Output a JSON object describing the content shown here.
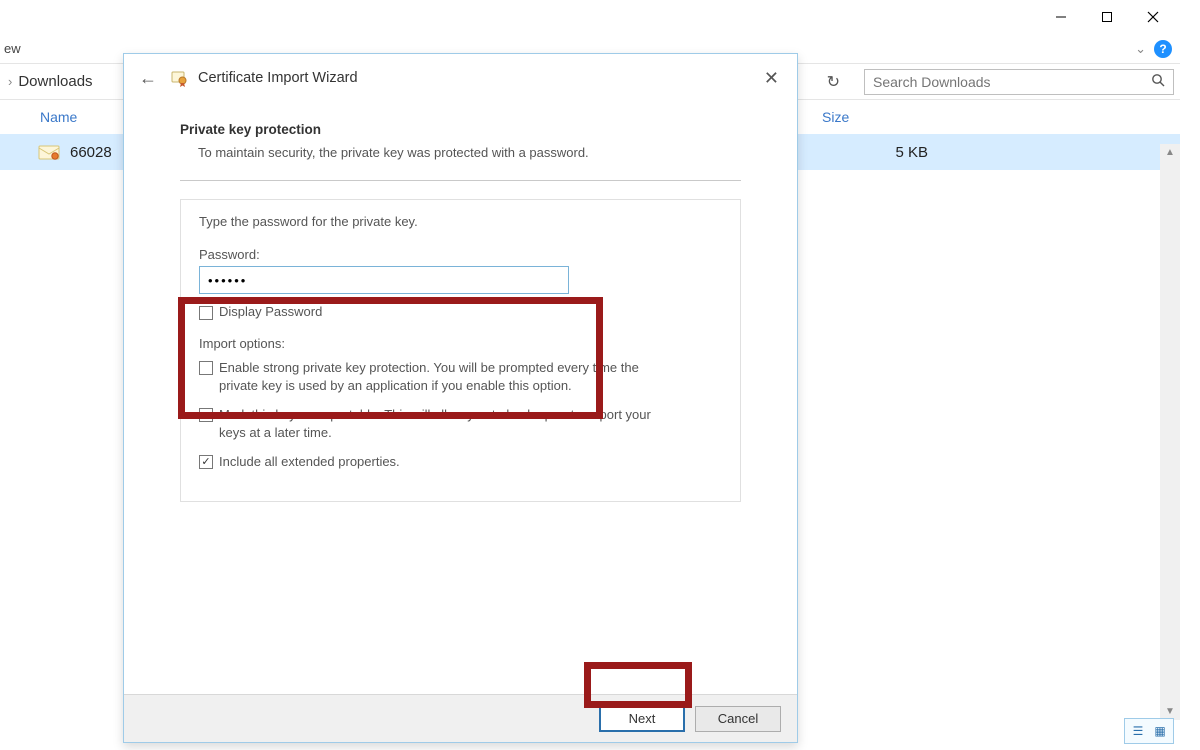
{
  "explorer": {
    "ribbon_tab": "ew",
    "breadcrumb": [
      "Downloads"
    ],
    "refresh_tooltip": "Refresh",
    "search_placeholder": "Search Downloads",
    "columns": {
      "name": "Name",
      "size": "Size"
    },
    "file": {
      "name": "66028",
      "size": "5 KB"
    }
  },
  "wizard": {
    "title": "Certificate Import Wizard",
    "section_title": "Private key protection",
    "section_sub": "To maintain security, the private key was protected with a password.",
    "instruction": "Type the password for the private key.",
    "password_label": "Password:",
    "password_value": "••••••",
    "display_password_label": "Display Password",
    "display_password_checked": false,
    "import_options_label": "Import options:",
    "opt_strong": "Enable strong private key protection. You will be prompted every time the private key is used by an application if you enable this option.",
    "opt_strong_checked": false,
    "opt_exportable": "Mark this key as exportable. This will allow you to back up or transport your keys at a later time.",
    "opt_exportable_checked": false,
    "opt_extended": "Include all extended properties.",
    "opt_extended_checked": true,
    "next_label": "Next",
    "cancel_label": "Cancel"
  }
}
